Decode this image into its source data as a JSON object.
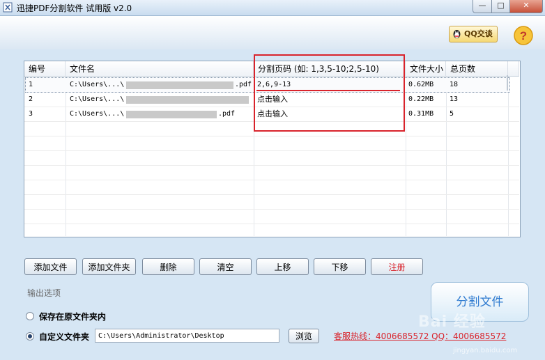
{
  "window": {
    "title": "迅捷PDF分割软件 试用版 v2.0",
    "minimize": "—",
    "maximize": "□",
    "close": "✕"
  },
  "header": {
    "qq_button": "QQ交谈",
    "help": "?"
  },
  "table": {
    "columns": [
      "编号",
      "文件名",
      "分割页码 (如: 1,3,5-10;2,5-10)",
      "文件大小",
      "总页数"
    ],
    "rows": [
      {
        "id": "1",
        "filename_prefix": "C:\\Users\\...\\",
        "filename_suffix": ".pdf",
        "pages": "2,6,9-13",
        "size": "0.62MB",
        "total": "18"
      },
      {
        "id": "2",
        "filename_prefix": "C:\\Users\\...\\",
        "filename_suffix": "",
        "pages": "点击输入",
        "size": "0.22MB",
        "total": "13"
      },
      {
        "id": "3",
        "filename_prefix": "C:\\Users\\...\\",
        "filename_suffix": ".pdf",
        "pages": "点击输入",
        "size": "0.31MB",
        "total": "5"
      }
    ]
  },
  "toolbar": {
    "add_file": "添加文件",
    "add_folder": "添加文件夹",
    "delete": "删除",
    "clear": "清空",
    "move_up": "上移",
    "move_down": "下移",
    "register": "注册"
  },
  "output": {
    "section_label": "输出选项",
    "option_original": "保存在原文件夹内",
    "option_custom": "自定义文件夹",
    "custom_path": "C:\\Users\\Administrator\\Desktop",
    "browse": "浏览",
    "selected": "custom"
  },
  "split_button": "分割文件",
  "hotline": "客服热线：4006685572 QQ：4006685572",
  "watermark": {
    "text": "Bai 经验",
    "url": "jingyan.baidu.com"
  },
  "colors": {
    "accent_red": "#d9232b",
    "split_blue": "#2f7bd0",
    "background": "#d6e6f4"
  }
}
